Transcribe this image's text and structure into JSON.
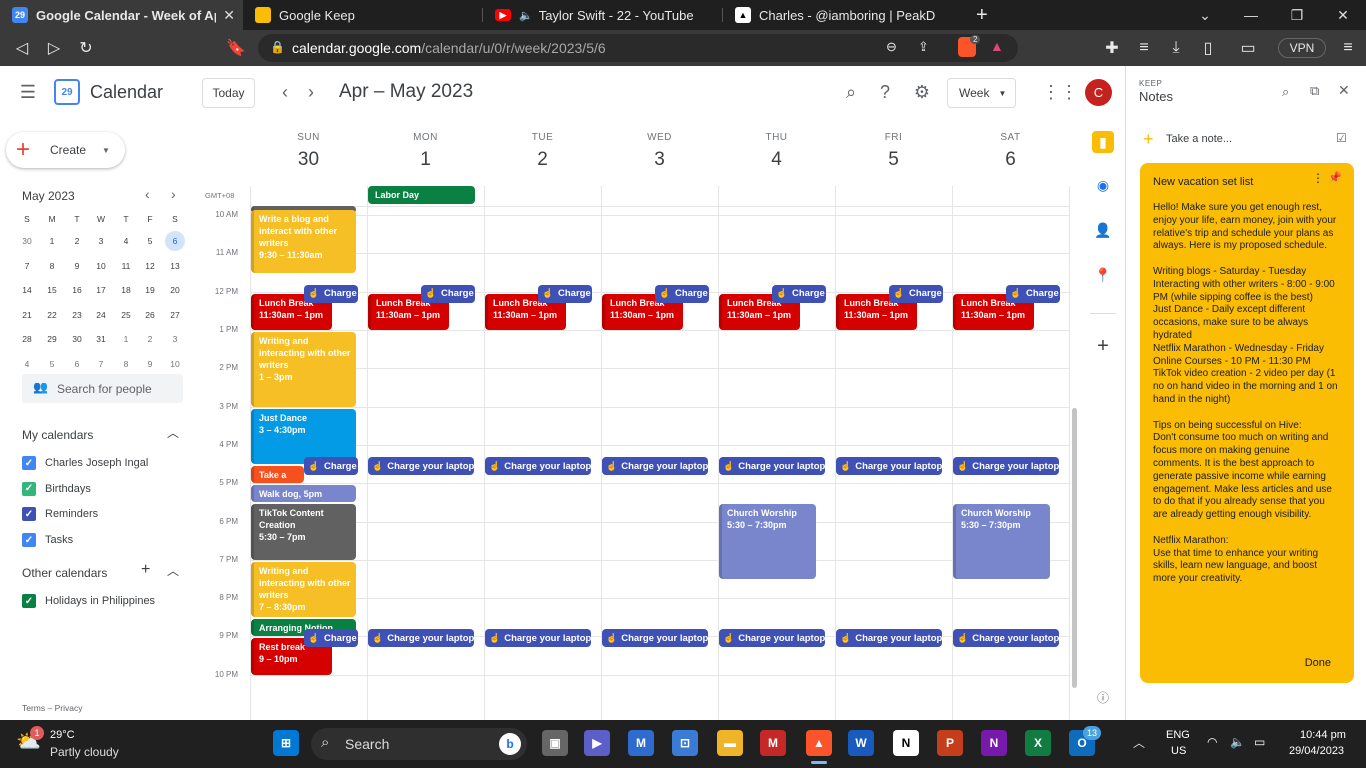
{
  "browser": {
    "tabs": [
      {
        "title": "Google Calendar - Week of April 3",
        "icon": "calendar-favicon",
        "color": "#4285f4"
      },
      {
        "title": "Google Keep",
        "icon": "keep-favicon",
        "color": "#fbbc04"
      },
      {
        "title": "Taylor Swift - 22 - YouTube",
        "icon": "youtube-favicon",
        "color": "#ff0000"
      },
      {
        "title": "Charles - @iamboring | PeakD",
        "icon": "peakd-favicon",
        "color": "#ffffff"
      }
    ],
    "new_tab": "+",
    "url_host": "calendar.google.com",
    "url_path": "/calendar/u/0/r/week/2023/5/6",
    "vpn_label": "VPN",
    "brave_badge": "2"
  },
  "header": {
    "app_name": "Calendar",
    "logo_number": "29",
    "today_label": "Today",
    "range_title": "Apr – May 2023",
    "view_label": "Week",
    "avatar_letter": "C"
  },
  "sidebar": {
    "create_label": "Create",
    "mini_title": "May 2023",
    "mini_dow": [
      "S",
      "M",
      "T",
      "W",
      "T",
      "F",
      "S"
    ],
    "mini_weeks": [
      [
        "30",
        "1",
        "2",
        "3",
        "4",
        "5",
        "6"
      ],
      [
        "7",
        "8",
        "9",
        "10",
        "11",
        "12",
        "13"
      ],
      [
        "14",
        "15",
        "16",
        "17",
        "18",
        "19",
        "20"
      ],
      [
        "21",
        "22",
        "23",
        "24",
        "25",
        "26",
        "27"
      ],
      [
        "28",
        "29",
        "30",
        "31",
        "1",
        "2",
        "3"
      ],
      [
        "4",
        "5",
        "6",
        "7",
        "8",
        "9",
        "10"
      ]
    ],
    "search_people": "Search for people",
    "my_calendars_title": "My calendars",
    "my_calendars": [
      {
        "name": "Charles Joseph Ingal",
        "color": "#4285f4"
      },
      {
        "name": "Birthdays",
        "color": "#33b679"
      },
      {
        "name": "Reminders",
        "color": "#3f51b5"
      },
      {
        "name": "Tasks",
        "color": "#4285f4"
      }
    ],
    "other_calendars_title": "Other calendars",
    "other_calendars": [
      {
        "name": "Holidays in Philippines",
        "color": "#0b8043"
      }
    ],
    "footer": "Terms – Privacy"
  },
  "grid": {
    "timezone": "GMT+08",
    "days": [
      {
        "dow": "SUN",
        "num": "30"
      },
      {
        "dow": "MON",
        "num": "1"
      },
      {
        "dow": "TUE",
        "num": "2"
      },
      {
        "dow": "WED",
        "num": "3"
      },
      {
        "dow": "THU",
        "num": "4"
      },
      {
        "dow": "FRI",
        "num": "5"
      },
      {
        "dow": "SAT",
        "num": "6"
      }
    ],
    "hours": [
      "10 AM",
      "11 AM",
      "12 PM",
      "1 PM",
      "2 PM",
      "3 PM",
      "4 PM",
      "5 PM",
      "6 PM",
      "7 PM",
      "8 PM",
      "9 PM",
      "10 PM"
    ],
    "all_day": {
      "title": "Labor Day",
      "day": 1,
      "color": "#0b8043"
    },
    "events": [
      {
        "day": 0,
        "start": 9.5,
        "end": 11.5,
        "title": "Write a blog and interact with other writers",
        "time": "9:30 – 11:30am",
        "color": "#f6bf26",
        "width": 1
      },
      {
        "day": 0,
        "start": 12,
        "end": 13,
        "title": "Lunch Break",
        "time": "11:30am – 1pm",
        "color": "#d50000",
        "width": 0.77
      },
      {
        "day": 1,
        "start": 12,
        "end": 13,
        "title": "Lunch Break",
        "time": "11:30am – 1pm",
        "color": "#d50000",
        "width": 0.77
      },
      {
        "day": 2,
        "start": 12,
        "end": 13,
        "title": "Lunch Break",
        "time": "11:30am – 1pm",
        "color": "#d50000",
        "width": 0.77
      },
      {
        "day": 3,
        "start": 12,
        "end": 13,
        "title": "Lunch Break",
        "time": "11:30am – 1pm",
        "color": "#d50000",
        "width": 0.77
      },
      {
        "day": 4,
        "start": 12,
        "end": 13,
        "title": "Lunch Break",
        "time": "11:30am – 1pm",
        "color": "#d50000",
        "width": 0.77
      },
      {
        "day": 5,
        "start": 12,
        "end": 13,
        "title": "Lunch Break",
        "time": "11:30am – 1pm",
        "color": "#d50000",
        "width": 0.77
      },
      {
        "day": 6,
        "start": 12,
        "end": 13,
        "title": "Lunch Break",
        "time": "11:30am – 1pm",
        "color": "#d50000",
        "width": 0.77
      },
      {
        "day": 0,
        "start": 13,
        "end": 15,
        "title": "Writing and interacting with other writers",
        "time": "1 – 3pm",
        "color": "#f6bf26",
        "width": 1
      },
      {
        "day": 0,
        "start": 15,
        "end": 16.5,
        "title": "Just Dance",
        "time": "3 – 4:30pm",
        "color": "#039be5",
        "width": 1
      },
      {
        "day": 0,
        "start": 16.5,
        "end": 17,
        "title": "Take a bath",
        "time": "",
        "color": "#f4511e",
        "width": 0.5
      },
      {
        "day": 0,
        "start": 17,
        "end": 17.5,
        "title": "Walk dog, 5pm",
        "time": "",
        "color": "#7986cb",
        "width": 1
      },
      {
        "day": 0,
        "start": 17.5,
        "end": 19,
        "title": "TikTok Content Creation",
        "time": "5:30 – 7pm",
        "color": "#616161",
        "width": 1
      },
      {
        "day": 0,
        "start": 19,
        "end": 20.5,
        "title": "Writing and interacting with other writers",
        "time": "7 – 8:30pm",
        "color": "#f6bf26",
        "width": 1
      },
      {
        "day": 0,
        "start": 20.5,
        "end": 21,
        "title": "Arranging Notion, 8:30p",
        "time": "",
        "color": "#0b8043",
        "width": 1
      },
      {
        "day": 0,
        "start": 21,
        "end": 22,
        "title": "Rest break",
        "time": "9 – 10pm",
        "color": "#d50000",
        "width": 0.77
      },
      {
        "day": 4,
        "start": 17.5,
        "end": 19.5,
        "title": "Church Worship",
        "time": "5:30 – 7:30pm",
        "color": "#7986cb",
        "width": 0.92
      },
      {
        "day": 6,
        "start": 17.5,
        "end": 19.5,
        "title": "Church Worship",
        "time": "5:30 – 7:30pm",
        "color": "#7986cb",
        "width": 0.92
      }
    ],
    "tasks": [
      {
        "day": 0,
        "hour": 12,
        "label": "Charge",
        "short": true
      },
      {
        "day": 1,
        "hour": 12,
        "label": "Charge",
        "short": true
      },
      {
        "day": 2,
        "hour": 12,
        "label": "Charge",
        "short": true
      },
      {
        "day": 3,
        "hour": 12,
        "label": "Charge",
        "short": true
      },
      {
        "day": 4,
        "hour": 12,
        "label": "Charge",
        "short": true
      },
      {
        "day": 5,
        "hour": 12,
        "label": "Charge",
        "short": true
      },
      {
        "day": 6,
        "hour": 12,
        "label": "Charge",
        "short": true
      },
      {
        "day": 0,
        "hour": 16.5,
        "label": "Charge",
        "short": true
      },
      {
        "day": 1,
        "hour": 16.5,
        "label": "Charge your laptop",
        "short": false
      },
      {
        "day": 2,
        "hour": 16.5,
        "label": "Charge your laptop",
        "short": false
      },
      {
        "day": 3,
        "hour": 16.5,
        "label": "Charge your laptop",
        "short": false
      },
      {
        "day": 4,
        "hour": 16.5,
        "label": "Charge your laptop",
        "short": false
      },
      {
        "day": 5,
        "hour": 16.5,
        "label": "Charge your laptop",
        "short": false
      },
      {
        "day": 6,
        "hour": 16.5,
        "label": "Charge your laptop",
        "short": false
      },
      {
        "day": 0,
        "hour": 21,
        "label": "Charge",
        "short": true
      },
      {
        "day": 1,
        "hour": 21,
        "label": "Charge your laptop",
        "short": false
      },
      {
        "day": 2,
        "hour": 21,
        "label": "Charge your laptop",
        "short": false
      },
      {
        "day": 3,
        "hour": 21,
        "label": "Charge your laptop",
        "short": false
      },
      {
        "day": 4,
        "hour": 21,
        "label": "Charge your laptop",
        "short": false
      },
      {
        "day": 5,
        "hour": 21,
        "label": "Charge your laptop",
        "short": false
      },
      {
        "day": 6,
        "hour": 21,
        "label": "Charge your laptop",
        "short": false
      }
    ]
  },
  "keep": {
    "app_label": "KEEP",
    "title": "Notes",
    "take_note": "Take a note...",
    "note_title": "New vacation set list",
    "note_body": "Hello! Make sure you get enough rest, enjoy your life, earn money, join with your relative's trip and schedule your plans as always. Here is my proposed schedule.\n\nWriting blogs - Saturday - Tuesday\nInteracting with other writers - 8:00 - 9:00 PM (while sipping coffee is the best)\nJust Dance - Daily except different occasions, make sure to be always hydrated\nNetflix Marathon - Wednesday - Friday\nOnline Courses - 10 PM - 11:30 PM\nTikTok video creation - 2 video per day (1 no on hand video in the morning and 1 on hand in the night)\n\nTips on being successful on Hive:\nDon't consume too much on writing and focus more on making genuine comments. It is the best approach to generate passive income while earning engagement. Make less articles and use to do that if you already sense that you are already getting enough visibility.\n\nNetflix Marathon:\nUse that time to enhance your writing skills, learn new language, and boost more your creativity.",
    "done_label": "Done",
    "note_color": "#fbbc04"
  },
  "taskbar": {
    "weather_temp": "29°C",
    "weather_desc": "Partly cloudy",
    "weather_badge": "1",
    "search_label": "Search",
    "lang_top": "ENG",
    "lang_bottom": "US",
    "time": "10:44 pm",
    "date": "29/04/2023",
    "outlook_badge": "13"
  }
}
